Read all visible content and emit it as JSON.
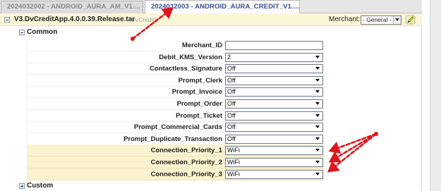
{
  "tabs": [
    {
      "label": "2024032002 - ANDROID_AURA_AM_V1....",
      "active": false
    },
    {
      "label": "2024032003 - ANDROID_AURA_CREDIT_V1....",
      "active": true
    }
  ],
  "app": {
    "title": "V3.DvCreditApp.4.0.0.39.Release.tar",
    "subtitle": "(DvCredit)",
    "merchant_label": "Merchant:",
    "merchant_value": "- General -"
  },
  "groups": {
    "common": "Common",
    "custom": "Custom"
  },
  "settings": [
    {
      "label": "Merchant_ID",
      "value": "",
      "kind": "input"
    },
    {
      "label": "Debit_KMS_Version",
      "value": "2",
      "kind": "select"
    },
    {
      "label": "Contactless_Signature",
      "value": "Off",
      "kind": "select"
    },
    {
      "label": "Prompt_Clerk",
      "value": "Off",
      "kind": "select"
    },
    {
      "label": "Prompt_Invoice",
      "value": "Off",
      "kind": "select"
    },
    {
      "label": "Prompt_Order",
      "value": "Off",
      "kind": "select"
    },
    {
      "label": "Prompt_Ticket",
      "value": "Off",
      "kind": "select"
    },
    {
      "label": "Prompt_Commercial_Cards",
      "value": "Off",
      "kind": "select"
    },
    {
      "label": "Prompt_Duplicate_Transaction",
      "value": "Off",
      "kind": "select"
    },
    {
      "label": "Connection_Priority_1",
      "value": "WiFi",
      "kind": "select",
      "highlight": true
    },
    {
      "label": "Connection_Priority_2",
      "value": "WiFi",
      "kind": "select",
      "highlight": true
    },
    {
      "label": "Connection_Priority_3",
      "value": "WiFi",
      "kind": "select",
      "highlight": true
    }
  ],
  "colors": {
    "annotation_arrow": "#e0141c",
    "highlight_row": "#fbf3cf",
    "active_tab_text": "#3b4f8a"
  },
  "icons": {
    "edit": "pencil-icon",
    "collapse": "minus-box-icon",
    "expand": "plus-box-icon"
  }
}
